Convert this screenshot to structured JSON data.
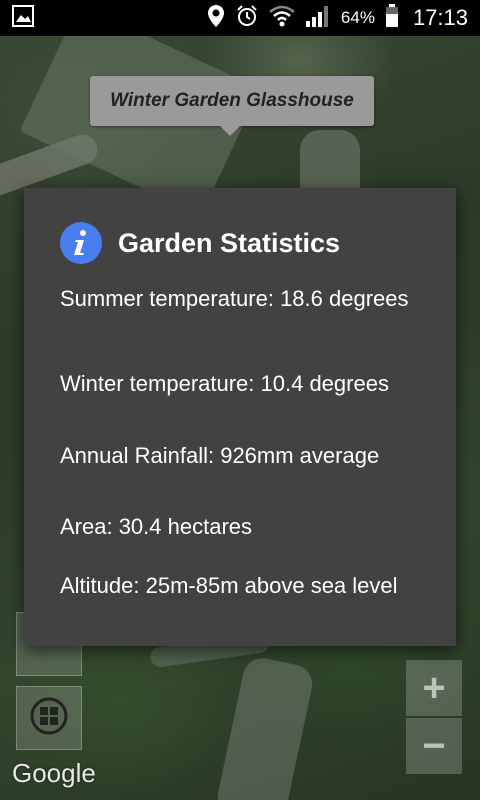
{
  "status_bar": {
    "battery_percent": "64%",
    "time": "17:13",
    "icons": [
      "gallery-icon",
      "location-icon",
      "alarm-icon",
      "wifi-icon",
      "signal-icon",
      "battery-icon"
    ]
  },
  "map": {
    "marker_label": "Winter Garden Glasshouse",
    "attribution": "Google",
    "zoom_in_label": "+",
    "zoom_out_label": "−"
  },
  "dialog": {
    "title": "Garden Statistics",
    "icon": "info-icon",
    "stats": [
      "Summer temperature: 18.6 degrees",
      "Winter temperature: 10.4 degrees",
      "Annual Rainfall: 926mm average",
      "Area: 30.4 hectares",
      "Altitude: 25m-85m above sea level"
    ]
  },
  "colors": {
    "dialog_bg": "#424242",
    "info_icon_bg": "#4a7ef0",
    "status_bar_bg": "#000000"
  }
}
